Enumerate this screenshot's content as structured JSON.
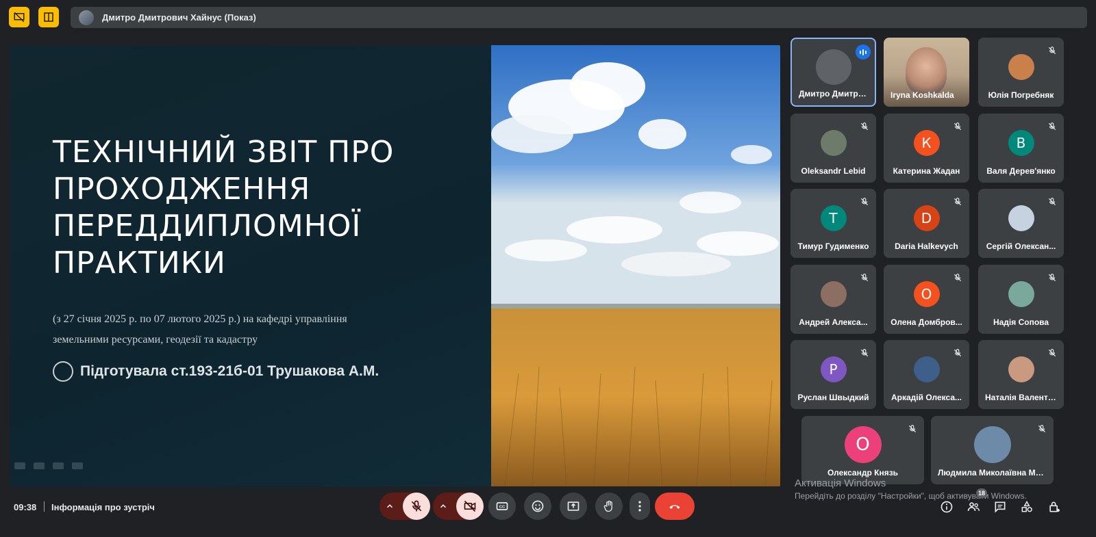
{
  "presenter": {
    "label": "Дмитро Дмитрович Хайнус (Показ)"
  },
  "slide": {
    "title": "ТЕХНІЧНИЙ ЗВІТ ПРО ПРОХОДЖЕННЯ ПЕРЕДДИПЛОМНОЇ ПРАКТИКИ",
    "subtitle_line1": "(з 27 січня 2025 р. по 07 лютого 2025 р.) на кафедрі управління",
    "subtitle_line2": "земельними  ресурсами, геодезії та кадастру",
    "author": "Підготувала ст.193-21б-01 Трушакова А.М."
  },
  "participants": [
    {
      "name": "Дмитро Дмитро...",
      "initial": "",
      "color": "#5f6368",
      "speaking": true
    },
    {
      "name": "Iryna Koshkalda",
      "initial": "",
      "color": "#6b7a5a",
      "video": true
    },
    {
      "name": "Юлія Погребняк",
      "initial": "",
      "color": "#c9804a",
      "muted": true
    },
    {
      "name": "Oleksandr Lebid",
      "initial": "",
      "color": "#6e7b6a",
      "muted": true
    },
    {
      "name": "Катерина Жадан",
      "initial": "К",
      "color": "#f4511e",
      "muted": true
    },
    {
      "name": "Валя Дерев'янко",
      "initial": "В",
      "color": "#00897b",
      "muted": true
    },
    {
      "name": "Тимур Гудименко",
      "initial": "Т",
      "color": "#00897b",
      "muted": true
    },
    {
      "name": "Daria Halkevych",
      "initial": "D",
      "color": "#d84315",
      "muted": true
    },
    {
      "name": "Сергій Олексан...",
      "initial": "",
      "color": "#c7d2e0",
      "muted": true
    },
    {
      "name": "Андрей Алекса...",
      "initial": "",
      "color": "#8d6e63",
      "muted": true
    },
    {
      "name": "Олена Домбров...",
      "initial": "О",
      "color": "#f4511e",
      "muted": true
    },
    {
      "name": "Надія Сопова",
      "initial": "",
      "color": "#7aa89a",
      "muted": true
    },
    {
      "name": "Руслан Швыдкий",
      "initial": "Р",
      "color": "#7e57c2",
      "muted": true
    },
    {
      "name": "Аркадій Олекса...",
      "initial": "",
      "color": "#3e5f8a",
      "muted": true
    },
    {
      "name": "Наталія Валенти...",
      "initial": "",
      "color": "#c99a80",
      "muted": true
    },
    {
      "name": "Олександр Князь",
      "initial": "О",
      "color": "#ec407a",
      "muted": true
    },
    {
      "name": "Людмила Миколаївна Ма...",
      "initial": "",
      "color": "#6d8aa8",
      "muted": true
    }
  ],
  "watermark": {
    "title": "Активація Windows",
    "subtitle": "Перейдіть до розділу \"Настройки\", щоб активувати Windows."
  },
  "bottom": {
    "time": "09:38",
    "meeting_info": "Інформація про зустріч",
    "participants_count": "18"
  },
  "colors": {
    "accent": "#8ab4f8",
    "end_call": "#ea4335",
    "highlight": "#fbbc04"
  }
}
